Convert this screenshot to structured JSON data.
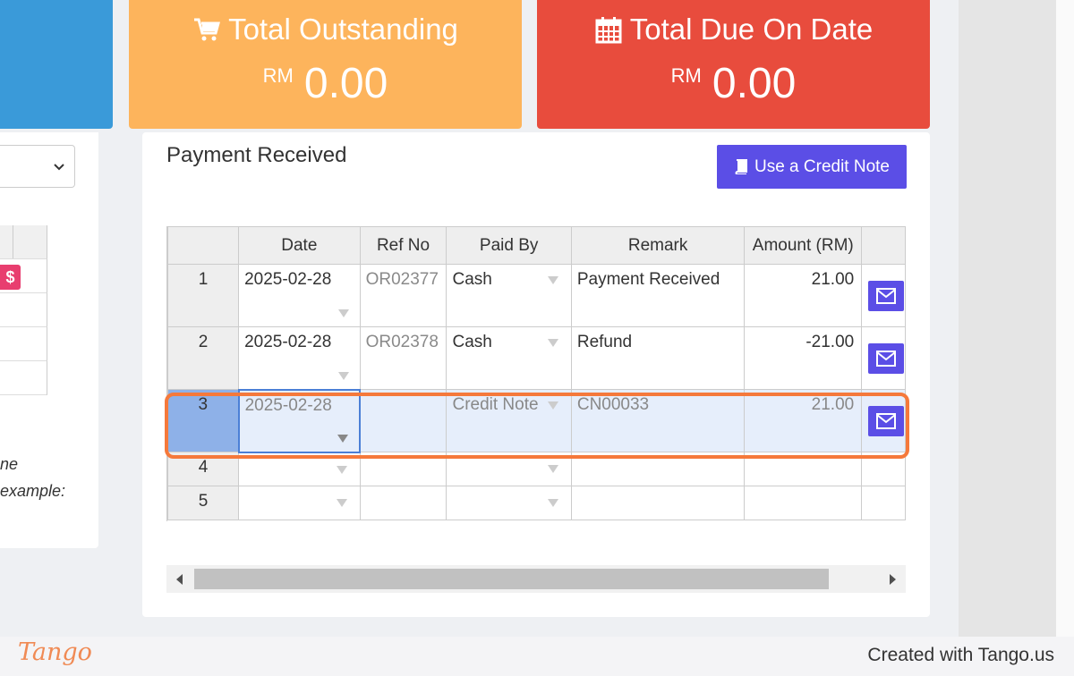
{
  "cards": {
    "outstanding": {
      "title": "Total Outstanding",
      "currency": "RM",
      "amount": "0.00",
      "icon": "cart-icon"
    },
    "due": {
      "title": "Total Due On Date",
      "currency": "RM",
      "amount": "0.00",
      "icon": "calendar-icon"
    }
  },
  "left": {
    "dollar": "$",
    "text_line1": "ne",
    "text_line2": "example:"
  },
  "panel": {
    "title": "Payment Received",
    "credit_button": "Use a Credit Note",
    "columns": [
      "Date",
      "Ref No",
      "Paid By",
      "Remark",
      "Amount (RM)"
    ],
    "rows": [
      {
        "num": "1",
        "date": "2025-02-28",
        "ref": "OR02377",
        "paid_by": "Cash",
        "remark": "Payment Received",
        "amount": "21.00"
      },
      {
        "num": "2",
        "date": "2025-02-28",
        "ref": "OR02378",
        "paid_by": "Cash",
        "remark": "Refund",
        "amount": "-21.00"
      },
      {
        "num": "3",
        "date": "2025-02-28",
        "ref": "",
        "paid_by": "Credit Note",
        "remark": "CN00033",
        "amount": "21.00"
      },
      {
        "num": "4"
      },
      {
        "num": "5"
      }
    ]
  },
  "footer": {
    "brand": "Tango",
    "created": "Created with Tango.us"
  },
  "colors": {
    "orange_card": "#fdb45c",
    "red_card": "#e84c3d",
    "blue_card": "#3a9ad9",
    "button": "#5b4ee6",
    "highlight": "#f5793b"
  }
}
